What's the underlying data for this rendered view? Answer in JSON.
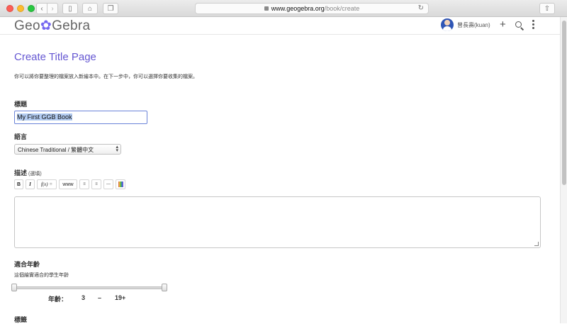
{
  "browser": {
    "url_host": "www.geogebra.org",
    "url_path": "/book/create"
  },
  "header": {
    "logo_prefix": "Geo",
    "logo_flower": "✿",
    "logo_suffix": "Gebra",
    "user_name": "曾長壽(kuan)"
  },
  "page": {
    "title": "Create Title Page",
    "intro": "你可以將你要整理的檔案放入新繪本中。在下一步中，你可以選擇你要收集的檔案。"
  },
  "form": {
    "title_label": "標題",
    "title_value": "My First GGB Book",
    "language_label": "語言",
    "language_value": "Chinese Traditional / 繁體中文",
    "description_label": "描述",
    "description_optional": "(選填)",
    "editor_buttons": [
      "B",
      "I",
      "f(x) =",
      "www",
      "≡",
      "≡",
      "—"
    ],
    "age_label": "適合年齡",
    "age_hint": "這個繪實適合的學生年齡",
    "age_caption": "年齡：",
    "age_min": "3",
    "age_sep": "–",
    "age_max": "19+",
    "age_min_fraction": 0,
    "age_max_fraction": 1,
    "tags_label": "標籤"
  },
  "colors": {
    "accent": "#6557d2",
    "input_focus_border": "#6a83d8",
    "selection": "#b3ccf2"
  }
}
